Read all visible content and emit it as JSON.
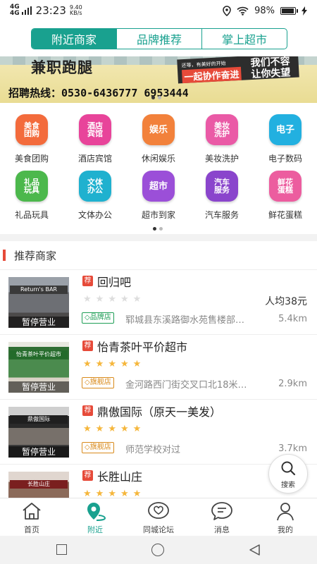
{
  "status_bar": {
    "signal1": "4G",
    "signal2": "4G",
    "time": "23:23",
    "net_speed": "9.40",
    "net_unit": "KB/s",
    "battery": "98%"
  },
  "top_tabs": [
    {
      "label": "附近商家",
      "active": true
    },
    {
      "label": "品牌推荐",
      "active": false
    },
    {
      "label": "掌上超市",
      "active": false
    }
  ],
  "banner": {
    "headline": "兼职跑腿",
    "sign_small": "还等，有美好的开始",
    "sign_a": "我们不容",
    "sign_b": "一起协作奋进",
    "sign_c": "让你失望",
    "hotline": "招聘热线：0530-6436777 6953444"
  },
  "categories": [
    {
      "label": "美食团购",
      "icon_text": "美食团购",
      "icon": "food-icon",
      "color": "#f36b3c"
    },
    {
      "label": "酒店宾馆",
      "icon_text": "酒店宾馆",
      "icon": "hotel-icon",
      "color": "#e8449a"
    },
    {
      "label": "休闲娱乐",
      "icon_text": "娱乐",
      "icon": "entertainment-icon",
      "color": "#f2813b"
    },
    {
      "label": "美妆洗护",
      "icon_text": "美妆洗护",
      "icon": "beauty-icon",
      "color": "#ea5aa6"
    },
    {
      "label": "电子数码",
      "icon_text": "电子",
      "icon": "electronics-icon",
      "color": "#22b0e0"
    },
    {
      "label": "礼品玩具",
      "icon_text": "礼品玩具",
      "icon": "gift-icon",
      "color": "#4cb84c"
    },
    {
      "label": "文体办公",
      "icon_text": "文体办公",
      "icon": "office-icon",
      "color": "#1fb1cf"
    },
    {
      "label": "超市到家",
      "icon_text": "超市",
      "icon": "supermarket-icon",
      "color": "#9b4fd8"
    },
    {
      "label": "汽车服务",
      "icon_text": "汽车服务",
      "icon": "car-icon",
      "color": "#8a45cc"
    },
    {
      "label": "鲜花蛋糕",
      "icon_text": "鲜花蛋糕",
      "icon": "flower-icon",
      "color": "#ec5d9f"
    }
  ],
  "recommended": {
    "title": "推荐商家",
    "badge": "荐",
    "closed_label": "暂停营业",
    "items": [
      {
        "name": "回归吧",
        "rating": 0,
        "avg_price": "人均38元",
        "tag": "品牌店",
        "tag_color": "green",
        "address": "郓城县东溪路御水苑售楼部…",
        "distance": "5.4km",
        "sign": "Return's BAR",
        "bg": "#6d6f74"
      },
      {
        "name": "怡青茶叶平价超市",
        "rating": 5,
        "avg_price": "",
        "tag": "旗舰店",
        "tag_color": "orange",
        "address": "金河路西门街交叉口北18米…",
        "distance": "2.9km",
        "sign": "怡青茶叶平价超市",
        "bg": "#2f6e33"
      },
      {
        "name": "鼎傲国际（原天一美发）",
        "rating": 5,
        "avg_price": "",
        "tag": "旗舰店",
        "tag_color": "orange",
        "address": "师范学校对过",
        "distance": "3.7km",
        "sign": "鼎傲国际",
        "bg": "#2a2a2a"
      },
      {
        "name": "长胜山庄",
        "rating": 5,
        "avg_price": "",
        "tag": "",
        "tag_color": "",
        "address": "",
        "distance": "",
        "sign": "长胜山庄",
        "bg": "#8b6a5a"
      }
    ]
  },
  "search_fab": {
    "label": "搜索"
  },
  "bottom_nav": [
    {
      "label": "首页",
      "icon": "home-icon",
      "active": false
    },
    {
      "label": "附近",
      "icon": "location-icon",
      "active": true
    },
    {
      "label": "同城论坛",
      "icon": "heart-chat-icon",
      "active": false
    },
    {
      "label": "消息",
      "icon": "message-icon",
      "active": false
    },
    {
      "label": "我的",
      "icon": "user-icon",
      "active": false
    }
  ],
  "colors": {
    "accent": "#19a18f",
    "badge": "#e64a39",
    "star": "#f5b63b"
  }
}
